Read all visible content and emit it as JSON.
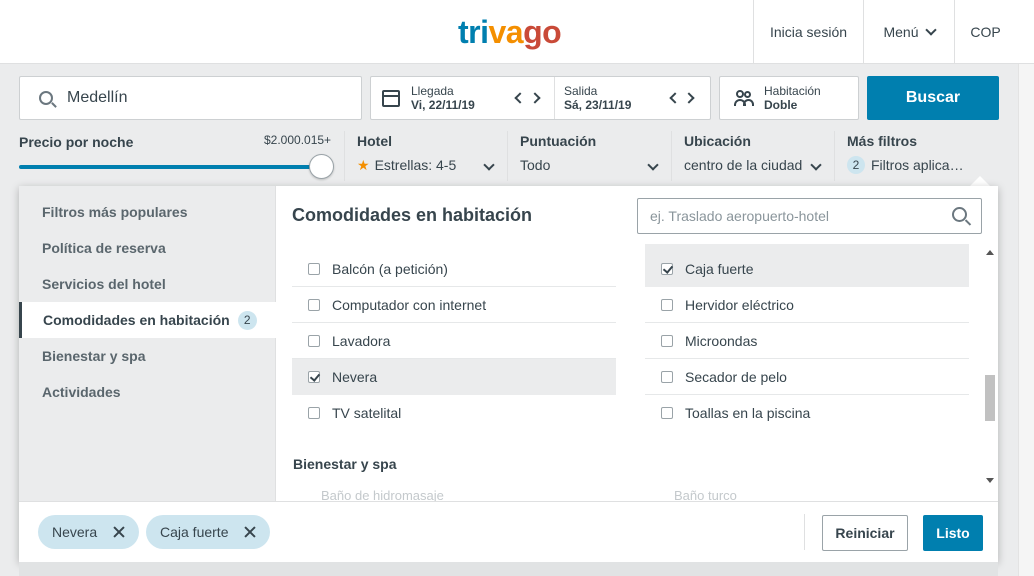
{
  "header": {
    "logo": {
      "part1": "tri",
      "part2": "va",
      "part3": "go"
    },
    "login": "Inicia sesión",
    "menu": "Menú",
    "currency": "COP"
  },
  "search": {
    "destination": "Medellín",
    "checkin": {
      "label": "Llegada",
      "value": "Vi, 22/11/19"
    },
    "checkout": {
      "label": "Salida",
      "value": "Sá, 23/11/19"
    },
    "room": {
      "label": "Habitación",
      "value": "Doble"
    },
    "button": "Buscar"
  },
  "filters": {
    "price": {
      "label": "Precio por noche",
      "value": "$2.000.015+",
      "level_fraction": 1.0
    },
    "hotel": {
      "title": "Hotel",
      "value": "Estrellas: 4-5"
    },
    "rating": {
      "title": "Puntuación",
      "value": "Todo"
    },
    "location": {
      "title": "Ubicación",
      "value": "centro de la ciudad"
    },
    "more": {
      "title": "Más filtros",
      "count": "2",
      "value": "Filtros aplica…"
    }
  },
  "panel": {
    "sidebar": [
      {
        "label": "Filtros más populares"
      },
      {
        "label": "Política de reserva"
      },
      {
        "label": "Servicios del hotel"
      },
      {
        "label": "Comodidades en habitación",
        "badge": "2"
      },
      {
        "label": "Bienestar y spa"
      },
      {
        "label": "Actividades"
      }
    ],
    "heading": "Comodidades en habitación",
    "search_placeholder": "ej. Traslado aeropuerto-hotel",
    "left_options": [
      {
        "label": "Balcón (a petición)",
        "checked": false
      },
      {
        "label": "Computador con internet",
        "checked": false
      },
      {
        "label": "Lavadora",
        "checked": false
      },
      {
        "label": "Nevera",
        "checked": true
      },
      {
        "label": "TV satelital",
        "checked": false
      }
    ],
    "right_options": [
      {
        "label": "Caja fuerte",
        "checked": true
      },
      {
        "label": "Hervidor eléctrico",
        "checked": false
      },
      {
        "label": "Microondas",
        "checked": false
      },
      {
        "label": "Secador de pelo",
        "checked": false
      },
      {
        "label": "Toallas en la piscina",
        "checked": false
      }
    ],
    "subsection": "Bienestar y spa",
    "faded_left": "Baño de hidromasaje",
    "faded_right": "Baño turco",
    "chips": [
      "Nevera",
      "Caja fuerte"
    ],
    "reset": "Reiniciar",
    "done": "Listo"
  },
  "colors": {
    "accent": "#007faf",
    "chip": "#cde5ef",
    "star": "#f48f00"
  }
}
